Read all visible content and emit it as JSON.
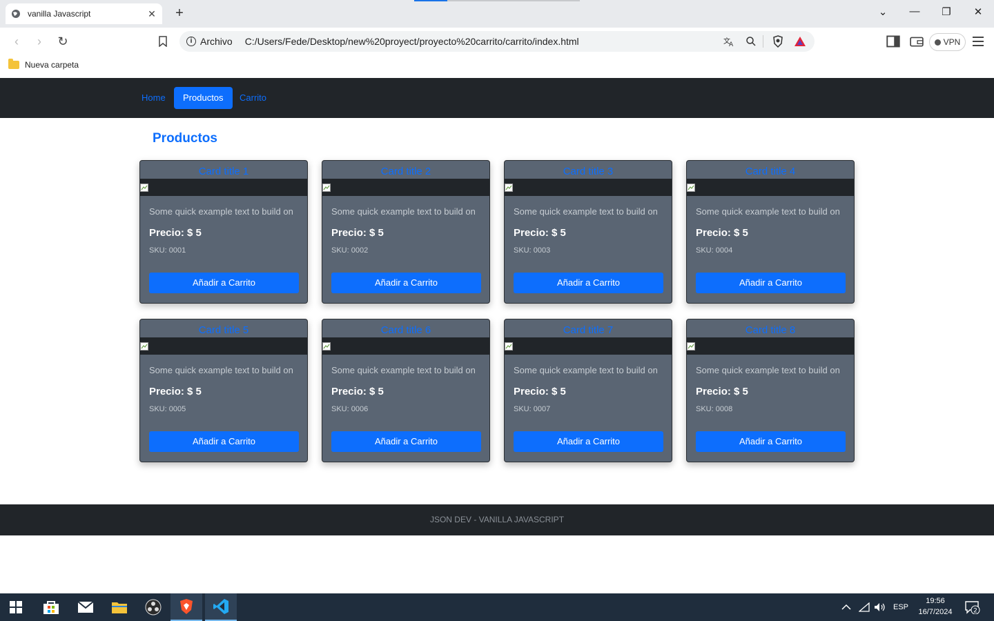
{
  "browser": {
    "tab_title": "vanilla Javascript",
    "new_tab": "+",
    "address_scheme": "Archivo",
    "address_url": "C:/Users/Fede/Desktop/new%20proyect/proyecto%20carrito/carrito/index.html",
    "vpn_label": "VPN",
    "bookmark_folder": "Nueva carpeta"
  },
  "nav": {
    "home": "Home",
    "productos": "Productos",
    "carrito": "Carrito"
  },
  "page": {
    "title": "Productos",
    "footer": "JSON DEV - VANILLA JAVASCRIPT"
  },
  "cards": [
    {
      "title": "Card title 1",
      "text": "Some quick example text to build on",
      "price": "Precio: $ 5",
      "sku": "SKU: 0001",
      "button": "Añadir a Carrito"
    },
    {
      "title": "Card title 2",
      "text": "Some quick example text to build on",
      "price": "Precio: $ 5",
      "sku": "SKU: 0002",
      "button": "Añadir a Carrito"
    },
    {
      "title": "Card title 3",
      "text": "Some quick example text to build on",
      "price": "Precio: $ 5",
      "sku": "SKU: 0003",
      "button": "Añadir a Carrito"
    },
    {
      "title": "Card title 4",
      "text": "Some quick example text to build on",
      "price": "Precio: $ 5",
      "sku": "SKU: 0004",
      "button": "Añadir a Carrito"
    },
    {
      "title": "Card title 5",
      "text": "Some quick example text to build on",
      "price": "Precio: $ 5",
      "sku": "SKU: 0005",
      "button": "Añadir a Carrito"
    },
    {
      "title": "Card title 6",
      "text": "Some quick example text to build on",
      "price": "Precio: $ 5",
      "sku": "SKU: 0006",
      "button": "Añadir a Carrito"
    },
    {
      "title": "Card title 7",
      "text": "Some quick example text to build on",
      "price": "Precio: $ 5",
      "sku": "SKU: 0007",
      "button": "Añadir a Carrito"
    },
    {
      "title": "Card title 8",
      "text": "Some quick example text to build on",
      "price": "Precio: $ 5",
      "sku": "SKU: 0008",
      "button": "Añadir a Carrito"
    }
  ],
  "taskbar": {
    "language": "ESP",
    "time": "19:56",
    "date": "16/7/2024",
    "notification_count": "2"
  },
  "colors": {
    "primary": "#0d6efd",
    "navbar": "#212529",
    "card_bg": "#5a6573"
  }
}
